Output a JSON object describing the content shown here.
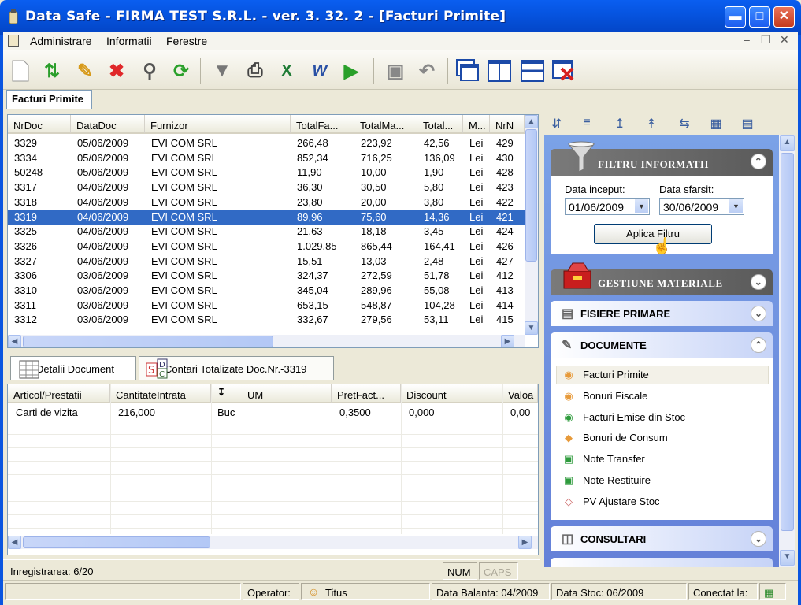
{
  "window": {
    "title": "Data Safe - FIRMA TEST S.R.L. - ver. 3. 32. 2 - [Facturi Primite]"
  },
  "menu": {
    "items": [
      "Administrare",
      "Informatii",
      "Ferestre"
    ]
  },
  "doc_tab": {
    "label": "Facturi Primite"
  },
  "invoices": {
    "columns": [
      "NrDoc",
      "DataDoc",
      "Furnizor",
      "TotalFa...",
      "TotalMa...",
      "Total...",
      "M...",
      "NrN"
    ],
    "rows": [
      [
        "3329",
        "05/06/2009",
        "EVI COM SRL",
        "266,48",
        "223,92",
        "42,56",
        "Lei",
        "429"
      ],
      [
        "3334",
        "05/06/2009",
        "EVI COM SRL",
        "852,34",
        "716,25",
        "136,09",
        "Lei",
        "430"
      ],
      [
        "50248",
        "05/06/2009",
        "EVI COM SRL",
        "11,90",
        "10,00",
        "1,90",
        "Lei",
        "428"
      ],
      [
        "3317",
        "04/06/2009",
        "EVI COM SRL",
        "36,30",
        "30,50",
        "5,80",
        "Lei",
        "423"
      ],
      [
        "3318",
        "04/06/2009",
        "EVI COM SRL",
        "23,80",
        "20,00",
        "3,80",
        "Lei",
        "422"
      ],
      [
        "3319",
        "04/06/2009",
        "EVI COM SRL",
        "89,96",
        "75,60",
        "14,36",
        "Lei",
        "421"
      ],
      [
        "3325",
        "04/06/2009",
        "EVI COM SRL",
        "21,63",
        "18,18",
        "3,45",
        "Lei",
        "424"
      ],
      [
        "3326",
        "04/06/2009",
        "EVI COM SRL",
        "1.029,85",
        "865,44",
        "164,41",
        "Lei",
        "426"
      ],
      [
        "3327",
        "04/06/2009",
        "EVI COM SRL",
        "15,51",
        "13,03",
        "2,48",
        "Lei",
        "427"
      ],
      [
        "3306",
        "03/06/2009",
        "EVI COM SRL",
        "324,37",
        "272,59",
        "51,78",
        "Lei",
        "412"
      ],
      [
        "3310",
        "03/06/2009",
        "EVI COM SRL",
        "345,04",
        "289,96",
        "55,08",
        "Lei",
        "413"
      ],
      [
        "3311",
        "03/06/2009",
        "EVI COM SRL",
        "653,15",
        "548,87",
        "104,28",
        "Lei",
        "414"
      ],
      [
        "3312",
        "03/06/2009",
        "EVI COM SRL",
        "332,67",
        "279,56",
        "53,11",
        "Lei",
        "415"
      ]
    ],
    "selected_index": 5
  },
  "lower_tabs": {
    "details": "Detalii Document",
    "accounts": "Contari Totalizate Doc.Nr.-3319"
  },
  "details": {
    "columns": [
      "Articol/Prestatii",
      "CantitateIntrata",
      "UM",
      "PretFact...",
      "Discount",
      "Valoa"
    ],
    "rows": [
      [
        "Carti de vizita",
        "216,000",
        "Buc",
        "0,3500",
        "0,000",
        "0,00"
      ]
    ]
  },
  "status": {
    "record": "Inregistrarea: 6/20",
    "num": "NUM",
    "caps": "CAPS",
    "operator_label": "Operator:",
    "operator_name": "Titus",
    "balance": "Data Balanta: 04/2009",
    "stock": "Data Stoc: 06/2009",
    "connected": "Conectat la:"
  },
  "filter": {
    "title": "FILTRU INFORMATII",
    "start_label": "Data inceput:",
    "end_label": "Data sfarsit:",
    "start_value": "01/06/2009",
    "end_value": "30/06/2009",
    "apply_label": "Aplica Filtru"
  },
  "task_groups": {
    "gestiune": "GESTIUNE MATERIALE",
    "fisiere": "FISIERE PRIMARE",
    "documente": "DOCUMENTE",
    "consultari": "CONSULTARI",
    "documente_items": [
      "Facturi Primite",
      "Bonuri Fiscale",
      "Facturi Emise din Stoc",
      "Bonuri de Consum",
      "Note Transfer",
      "Note Restituire",
      "PV Ajustare Stoc"
    ]
  }
}
